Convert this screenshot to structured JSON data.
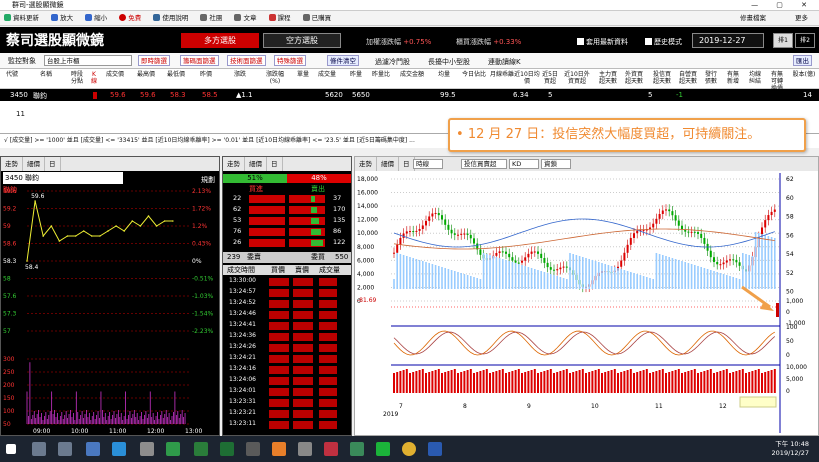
{
  "window": {
    "title": "群司-選股顯微鏡",
    "controls": "— ▢ ✕"
  },
  "menu": {
    "items": [
      "資料更新",
      "放大",
      "縮小",
      "免費",
      "使用說明",
      "社團",
      "文章",
      "課程",
      "已購買"
    ],
    "right": [
      "修畫檔案",
      "更多"
    ]
  },
  "banner": {
    "logo": "蔡司選股顯微鏡",
    "long_button": "多方選股",
    "short_button": "空方選股",
    "stat1_label": "加權漲跌幅",
    "stat1_value": "+0.75%",
    "stat2_label": "櫃買漲跌幅",
    "stat2_value": "+0.33%",
    "check1": "套用最新資料",
    "check2": "歷史模式",
    "date": "2019-12-27",
    "tab1": "排1",
    "tab2": "排2"
  },
  "toolbar": {
    "monitor_label": "監控對象",
    "monitor_value": "台股上市櫃",
    "btns": [
      "即時篩選",
      "籌碼面篩選",
      "技術面篩選",
      "特殊篩選"
    ],
    "clear": "條件清空",
    "checks": [
      "過濾冷門股",
      "長擾中小型股",
      "連動讀線K"
    ],
    "exit": "匯出"
  },
  "columns": [
    "代號",
    "名稱",
    "時段分點",
    "K線",
    "成交價",
    "最高價",
    "最低價",
    "昨價",
    "漲跌",
    "漲跌幅(%)",
    "單量",
    "成交量",
    "昨量",
    "昨量比",
    "成交金額",
    "均量",
    "今日佔比",
    "月線乖離",
    "近10日均價",
    "近5日買超",
    "近10日外資買超",
    "主力買超天數",
    "外資買超天數",
    "投信買超天數",
    "自營買超天數",
    "發行張數",
    "有無新增",
    "均線糾結",
    "有無可轉換債",
    "股本(億)"
  ],
  "row": {
    "code": "3450",
    "name": "聯鈞",
    "price": "59.6",
    "high": "59.6",
    "low": "58.3",
    "prev": "58.5",
    "change": "▲1.1",
    "volume": "5620",
    "yvol": "5650",
    "avg": "99.5",
    "c10": "6.34",
    "c5": "5",
    "d1": "5",
    "d2": "-1",
    "cap": "14"
  },
  "blank_row_label": "11",
  "condition_text": "√ [成交量] >= '1000' 並且 [成交量] <= '33415' 並且 [近10日均線乖離率] >= '0.01' 並且 [近10日均線乖離率] <= '23.5' 並且 [近5日籌碼集中度] ...",
  "callout": "12 月 27 日：投信突然大幅度買超，可持續關注。",
  "left_panel": {
    "tabs": [
      "走勢",
      "細價",
      "日"
    ],
    "stock": "3450 聯鈞",
    "title": "聯鈞",
    "btn": "規劃",
    "price_ticks": [
      "59.6",
      "59.2",
      "59",
      "58.6",
      "58.3",
      "58",
      "57.6",
      "57.3",
      "57"
    ],
    "pct_ticks": [
      "2.13%",
      "1.72%",
      "1.2%",
      "0.43%",
      "0%",
      "-0.51%",
      "-1.03%",
      "-1.54%",
      "-2.23%"
    ],
    "high_label": "59.6",
    "low_label": "58.4",
    "vol_ticks": [
      "300",
      "250",
      "200",
      "150",
      "100",
      "50"
    ],
    "time_ticks": [
      "09:00",
      "10:00",
      "11:00",
      "12:00",
      "13:00"
    ]
  },
  "mid_panel": {
    "tabs": [
      "走勢",
      "細價",
      "日"
    ],
    "buy_pct": "51%",
    "sell_pct": "48%",
    "buy_label": "買進",
    "sell_label": "賣出",
    "book_left": [
      "22",
      "62",
      "53",
      "76",
      "26"
    ],
    "book_right": [
      "37",
      "170",
      "135",
      "86",
      "122"
    ],
    "footer_left": "239",
    "footer_mid": "委賣",
    "footer_mid2": "委買",
    "footer_right": "550",
    "trade_headers": [
      "成交時間",
      "買價",
      "賣價",
      "成交量"
    ],
    "trade_times": [
      "13:30:00",
      "13:24:57",
      "13:24:52",
      "13:24:46",
      "13:24:41",
      "13:24:36",
      "13:24:26",
      "13:24:21",
      "13:24:16",
      "13:24:06",
      "13:24:01",
      "13:23:31",
      "13:23:21",
      "13:23:11"
    ]
  },
  "right_panel": {
    "tabs": [
      "走勢",
      "細價",
      "日"
    ],
    "dropdown1": "時線",
    "dropdown2": "投信買賣超",
    "dropdown3": "KD",
    "dropdown4": "資鎖",
    "left_ticks": [
      "18,000",
      "16,000",
      "14,000",
      "12,000",
      "10,000",
      "8,000",
      "6,000",
      "4,000",
      "2,000",
      "0"
    ],
    "right_ticks": [
      "62",
      "60",
      "58",
      "56",
      "54",
      "52",
      "50"
    ],
    "low_marker": "-81.69",
    "ind1_ticks": [
      "1,000",
      "0",
      "-1,000"
    ],
    "ind2_ticks": [
      "100",
      "50",
      "0"
    ],
    "ind3_ticks": [
      "10,000",
      "5,000",
      "0"
    ],
    "x_ticks": [
      "7",
      "8",
      "9",
      "10",
      "11",
      "12"
    ],
    "year": "2019"
  },
  "chart_data": {
    "type": "line",
    "title": "",
    "x": [
      "09:00",
      "09:15",
      "09:30",
      "09:45",
      "10:00",
      "10:15",
      "10:30",
      "10:45",
      "11:00",
      "11:15",
      "11:30",
      "11:45",
      "12:00",
      "12:15",
      "12:30",
      "12:45",
      "13:00",
      "13:15",
      "13:30"
    ],
    "series": [
      {
        "values": [
          58.4,
          59.6,
          58.9,
          59.1,
          58.8,
          58.9,
          58.9,
          59.0,
          58.9,
          58.9,
          59.0,
          59.1,
          59.0,
          59.2,
          59.1,
          59.3,
          59.1,
          59.2,
          59.2
        ]
      }
    ],
    "ylim": [
      57,
      59.8
    ],
    "xlabel": "",
    "ylabel": ""
  },
  "taskbar": {
    "time": "下午 10:48",
    "date": "2019/12/27"
  },
  "colors": {
    "red": "#cc0000",
    "green": "#22aa22",
    "orange": "#f0a04a",
    "black": "#000000"
  }
}
